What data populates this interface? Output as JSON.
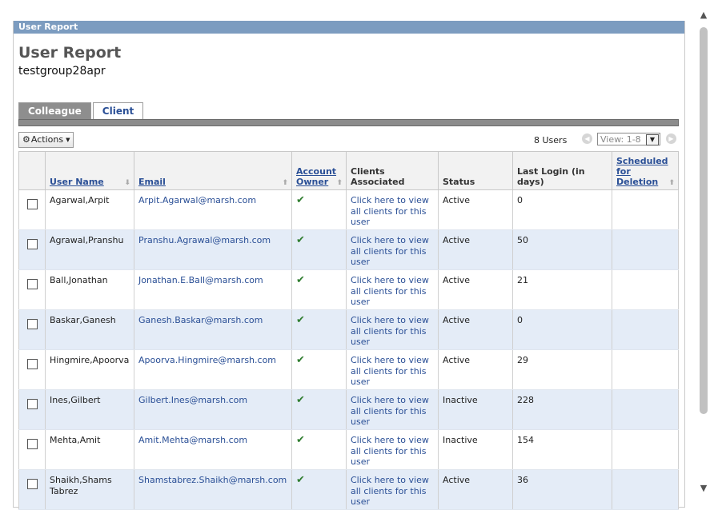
{
  "titlebar": "User Report",
  "heading": "User Report",
  "subheading": "testgroup28apr",
  "tabs": [
    {
      "label": "Colleague",
      "active": true
    },
    {
      "label": "Client",
      "active": false
    }
  ],
  "toolbar": {
    "actions_label": "Actions",
    "users_count": "8  Users",
    "view_value": "View: 1-8"
  },
  "columns": [
    {
      "label": "User Name",
      "sortable": true
    },
    {
      "label": "Email",
      "sortable": true
    },
    {
      "label": "Account Owner",
      "sortable": true
    },
    {
      "label": "Clients Associated",
      "sortable": false
    },
    {
      "label": "Status",
      "sortable": false
    },
    {
      "label": "Last Login (in days)",
      "sortable": false
    },
    {
      "label": "Scheduled for Deletion",
      "sortable": true
    }
  ],
  "rows": [
    {
      "name": "Agarwal,Arpit",
      "email": "Arpit.Agarwal@marsh.com",
      "owner_check": "✔",
      "clients": "Click here to view all clients for this user",
      "status": "Active",
      "last_login": "0",
      "scheduled": ""
    },
    {
      "name": "Agrawal,Pranshu",
      "email": "Pranshu.Agrawal@marsh.com",
      "owner_check": "✔",
      "clients": "Click here to view all clients for this user",
      "status": "Active",
      "last_login": "50",
      "scheduled": ""
    },
    {
      "name": "Ball,Jonathan",
      "email": "Jonathan.E.Ball@marsh.com",
      "owner_check": "✔",
      "clients": "Click here to view all clients for this user",
      "status": "Active",
      "last_login": "21",
      "scheduled": ""
    },
    {
      "name": "Baskar,Ganesh",
      "email": "Ganesh.Baskar@marsh.com",
      "owner_check": "✔",
      "clients": "Click here to view all clients for this user",
      "status": "Active",
      "last_login": "0",
      "scheduled": ""
    },
    {
      "name": "Hingmire,Apoorva",
      "email": "Apoorva.Hingmire@marsh.com",
      "owner_check": "✔",
      "clients": "Click here to view all clients for this user",
      "status": "Active",
      "last_login": "29",
      "scheduled": ""
    },
    {
      "name": "Ines,Gilbert",
      "email": "Gilbert.Ines@marsh.com",
      "owner_check": "✔",
      "clients": "Click here to view all clients for this user",
      "status": "Inactive",
      "last_login": "228",
      "scheduled": ""
    },
    {
      "name": "Mehta,Amit",
      "email": "Amit.Mehta@marsh.com",
      "owner_check": "✔",
      "clients": "Click here to view all clients for this user",
      "status": "Inactive",
      "last_login": "154",
      "scheduled": ""
    },
    {
      "name": "Shaikh,Shams Tabrez",
      "email": "Shamstabrez.Shaikh@marsh.com",
      "owner_check": "✔",
      "clients": "Click here to view all clients for this user",
      "status": "Active",
      "last_login": "36",
      "scheduled": ""
    }
  ],
  "icons": {
    "actions": "gear-icon",
    "actions_caret": "chevron-down-icon",
    "pager_prev": "chevron-left-icon",
    "pager_next": "chevron-right-icon",
    "scroll_up": "chevron-up-icon",
    "scroll_down": "chevron-down-icon"
  },
  "colors": {
    "titlebar": "#7c9cc0",
    "link": "#2a4f96",
    "alt_row": "#e4ecf7",
    "check": "#2f7d2f"
  }
}
